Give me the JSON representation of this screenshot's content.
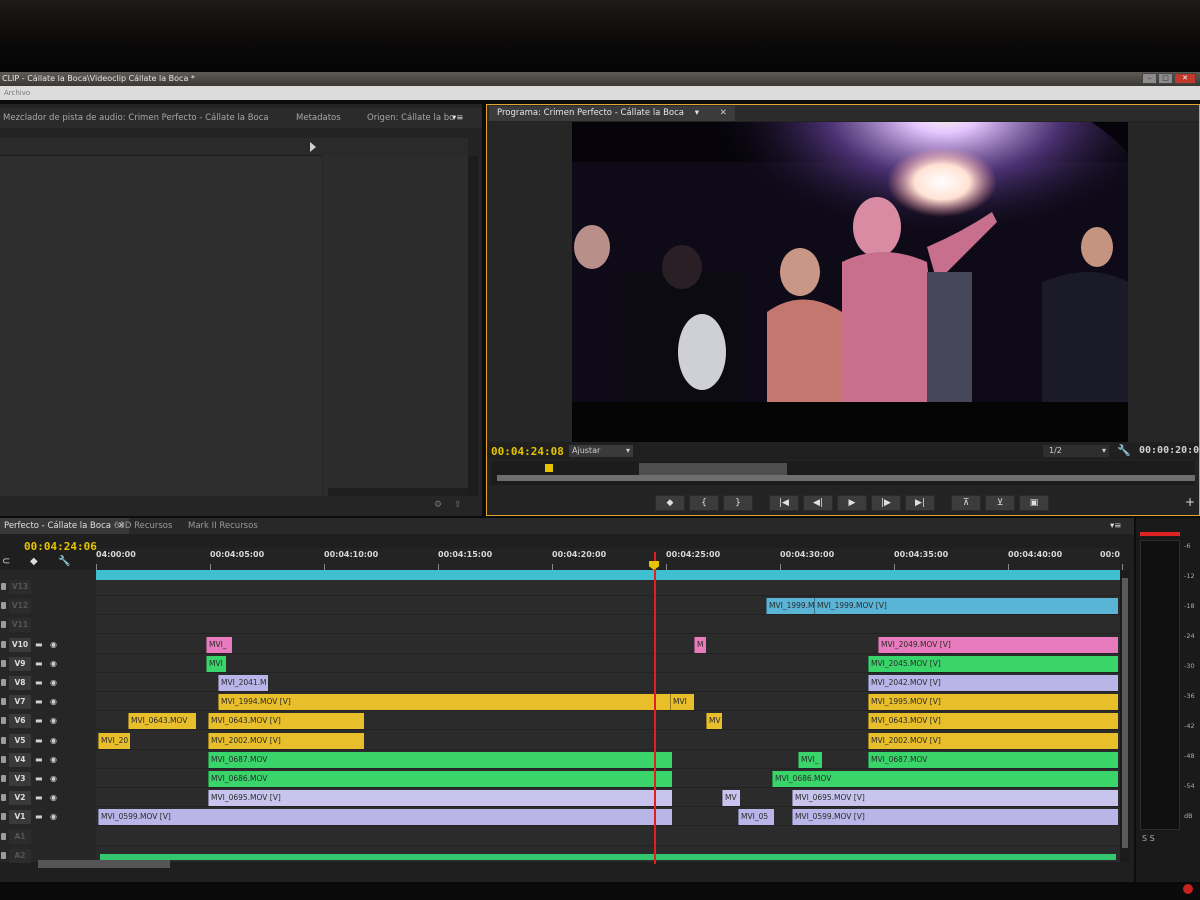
{
  "window": {
    "title": "CLIP - Cállate la Boca\\Videoclip Cállate la Boca *",
    "menu": "Archivo"
  },
  "source_panel": {
    "tabs": [
      "Mezclador de pista de audio: Crimen Perfecto - Cállate la Boca",
      "Metadatos",
      "Origen: Cállate la bo"
    ]
  },
  "program_monitor": {
    "tab_label": "Programa: Crimen Perfecto - Cállate la Boca",
    "timecode": "00:04:24:08",
    "fit": "Ajustar",
    "resolution": "1/2",
    "duration": "00:00:20:00",
    "buttons": [
      "marker-icon",
      "mark-in-icon",
      "mark-out-icon",
      "go-to-in-icon",
      "step-back-icon",
      "play-icon",
      "step-forward-icon",
      "go-to-out-icon",
      "lift-icon",
      "extract-icon",
      "export-frame-icon"
    ]
  },
  "timeline": {
    "tabs": [
      "Perfecto - Cállate la Boca",
      "60D Recursos",
      "Mark II Recursos"
    ],
    "timecode": "00:04:24:06",
    "ruler": [
      "04:00:00",
      "00:04:05:00",
      "00:04:10:00",
      "00:04:15:00",
      "00:04:20:00",
      "00:04:25:00",
      "00:04:30:00",
      "00:04:35:00",
      "00:04:40:00",
      "00:0"
    ],
    "tracks": [
      {
        "name": "V13",
        "dim": true
      },
      {
        "name": "V12",
        "dim": true
      },
      {
        "name": "V11",
        "dim": true
      },
      {
        "name": "V10",
        "dim": false
      },
      {
        "name": "V9",
        "dim": false
      },
      {
        "name": "V8",
        "dim": false
      },
      {
        "name": "V7",
        "dim": false
      },
      {
        "name": "V6",
        "dim": false
      },
      {
        "name": "V5",
        "dim": false
      },
      {
        "name": "V4",
        "dim": false
      },
      {
        "name": "V3",
        "dim": false
      },
      {
        "name": "V2",
        "dim": false
      },
      {
        "name": "V1",
        "dim": false
      },
      {
        "name": "A1",
        "dim": true
      },
      {
        "name": "A2",
        "dim": true
      }
    ],
    "clips": [
      {
        "track": 1,
        "start": 670,
        "end": 718,
        "label": "MVI_1999.M",
        "color": "#5ab4d6"
      },
      {
        "track": 1,
        "start": 718,
        "end": 1022,
        "label": "MVI_1999.MOV [V]",
        "color": "#5ab4d6"
      },
      {
        "track": 3,
        "start": 110,
        "end": 136,
        "label": "MVI_",
        "color": "#e87bbd"
      },
      {
        "track": 3,
        "start": 598,
        "end": 610,
        "label": "M",
        "color": "#e87bbd"
      },
      {
        "track": 3,
        "start": 782,
        "end": 1022,
        "label": "MVI_2049.MOV [V]",
        "color": "#e87bbd"
      },
      {
        "track": 4,
        "start": 110,
        "end": 130,
        "label": "MVI",
        "color": "#39d56b"
      },
      {
        "track": 4,
        "start": 772,
        "end": 1022,
        "label": "MVI_2045.MOV [V]",
        "color": "#39d56b"
      },
      {
        "track": 5,
        "start": 122,
        "end": 172,
        "label": "MVI_2041.M",
        "color": "#b9b5e8"
      },
      {
        "track": 5,
        "start": 772,
        "end": 1022,
        "label": "MVI_2042.MOV [V]",
        "color": "#b9b5e8"
      },
      {
        "track": 6,
        "start": 122,
        "end": 574,
        "label": "MVI_1994.MOV [V]",
        "color": "#e8bf2a"
      },
      {
        "track": 6,
        "start": 574,
        "end": 598,
        "label": "MVI",
        "color": "#e8bf2a"
      },
      {
        "track": 6,
        "start": 772,
        "end": 1022,
        "label": "MVI_1995.MOV [V]",
        "color": "#e8bf2a"
      },
      {
        "track": 7,
        "start": 32,
        "end": 100,
        "label": "MVI_0643.MOV",
        "color": "#e8bf2a"
      },
      {
        "track": 7,
        "start": 112,
        "end": 268,
        "label": "MVI_0643.MOV [V]",
        "color": "#e8bf2a"
      },
      {
        "track": 7,
        "start": 610,
        "end": 626,
        "label": "MV",
        "color": "#e8bf2a"
      },
      {
        "track": 7,
        "start": 772,
        "end": 1022,
        "label": "MVI_0643.MOV [V]",
        "color": "#e8bf2a"
      },
      {
        "track": 8,
        "start": 2,
        "end": 34,
        "label": "MVI_20",
        "color": "#e8bf2a"
      },
      {
        "track": 8,
        "start": 112,
        "end": 268,
        "label": "MVI_2002.MOV [V]",
        "color": "#e8bf2a"
      },
      {
        "track": 8,
        "start": 772,
        "end": 1022,
        "label": "MVI_2002.MOV [V]",
        "color": "#e8bf2a"
      },
      {
        "track": 9,
        "start": 112,
        "end": 576,
        "label": "MVI_0687.MOV",
        "color": "#39d56b"
      },
      {
        "track": 9,
        "start": 702,
        "end": 726,
        "label": "MVI_",
        "color": "#39d56b"
      },
      {
        "track": 9,
        "start": 772,
        "end": 1022,
        "label": "MVI_0687.MOV",
        "color": "#39d56b"
      },
      {
        "track": 10,
        "start": 112,
        "end": 576,
        "label": "MVI_0686.MOV",
        "color": "#39d56b"
      },
      {
        "track": 10,
        "start": 676,
        "end": 1022,
        "label": "MVI_0686.MOV",
        "color": "#39d56b"
      },
      {
        "track": 11,
        "start": 112,
        "end": 576,
        "label": "MVI_0695.MOV [V]",
        "color": "#c8c4ee"
      },
      {
        "track": 11,
        "start": 626,
        "end": 644,
        "label": "MV",
        "color": "#c8c4ee"
      },
      {
        "track": 11,
        "start": 696,
        "end": 1022,
        "label": "MVI_0695.MOV [V]",
        "color": "#c8c4ee"
      },
      {
        "track": 12,
        "start": 2,
        "end": 576,
        "label": "MVI_0599.MOV [V]",
        "color": "#b9b5e8"
      },
      {
        "track": 12,
        "start": 642,
        "end": 678,
        "label": "MVI_05",
        "color": "#b9b5e8"
      },
      {
        "track": 12,
        "start": 696,
        "end": 1022,
        "label": "MVI_0599.MOV [V]",
        "color": "#b9b5e8"
      }
    ]
  },
  "meter": {
    "db": [
      "-6",
      "-12",
      "-18",
      "-24",
      "-30",
      "-36",
      "-42",
      "-48",
      "-54",
      "dB"
    ],
    "solo": "S   S"
  }
}
